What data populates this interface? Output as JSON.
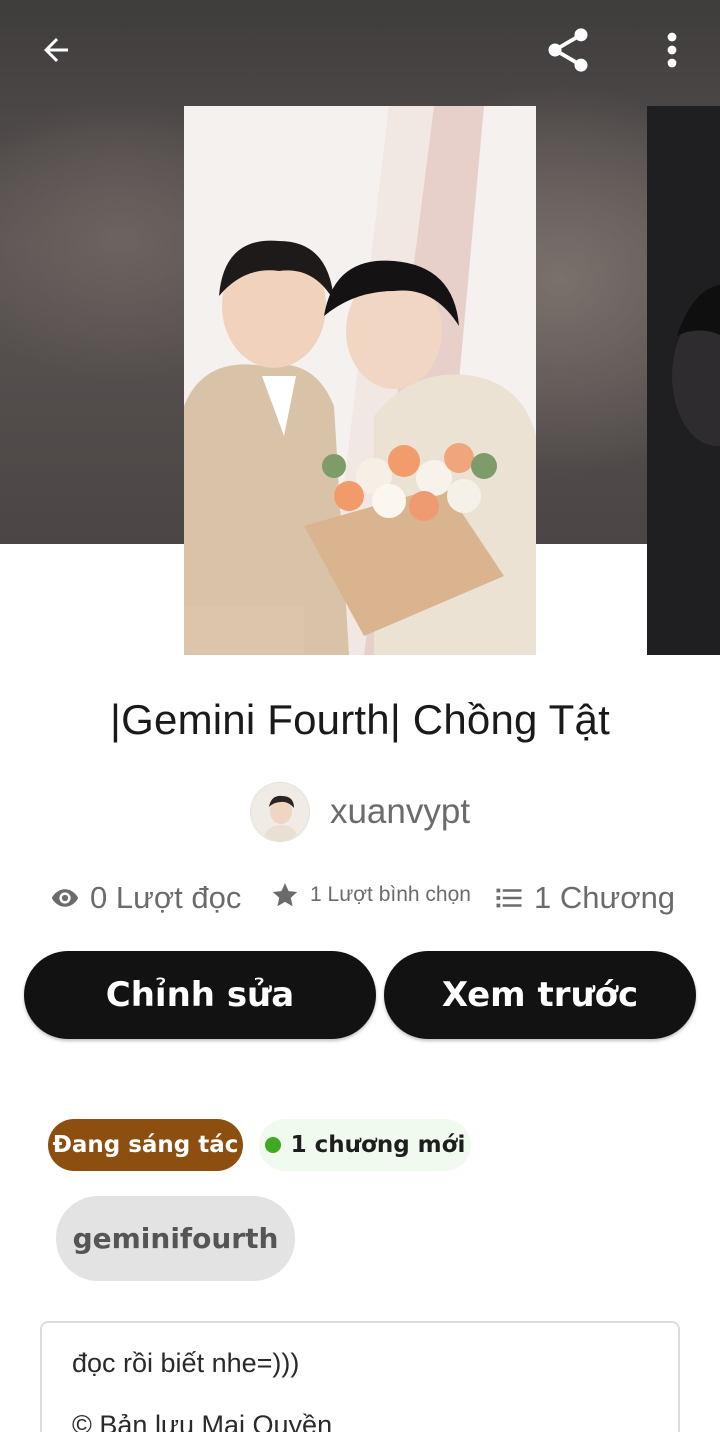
{
  "header": {
    "back_icon": "arrow-left-icon",
    "share_icon": "share-icon",
    "more_icon": "more-vertical-icon"
  },
  "story": {
    "title": "|Gemini Fourth| Chồng Tật",
    "author": "xuanvypt"
  },
  "stats": {
    "reads": "0 Lượt đọc",
    "votes": "1 Lượt bình chọn",
    "parts": "1 Chương"
  },
  "actions": {
    "edit_label": "Chỉnh sửa",
    "preview_label": "Xem trước"
  },
  "tags": {
    "status": "Đang sáng tác",
    "new_parts": "1 chương mới",
    "chip": "geminifourth"
  },
  "description": {
    "line1": "đọc rồi biết nhe=)))",
    "line2": "© Bản lưu Mai Quyền"
  },
  "colors": {
    "button_bg": "#121212",
    "status_tag_bg": "#8c4f10",
    "new_dot": "#3faa21"
  }
}
